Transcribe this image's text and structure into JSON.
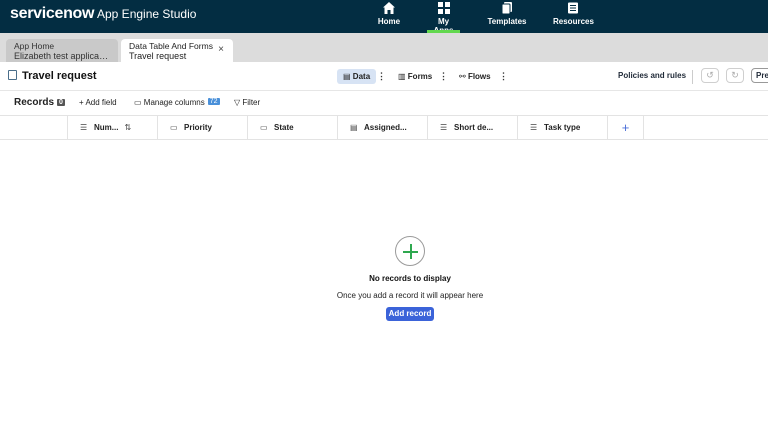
{
  "topnav": {
    "brand": "servicenow",
    "product": "App Engine Studio",
    "items": [
      {
        "label": "Home",
        "icon": "home-icon"
      },
      {
        "label": "My Apps",
        "icon": "grid-icon"
      },
      {
        "label": "Templates",
        "icon": "templates-icon"
      },
      {
        "label": "Resources",
        "icon": "book-icon"
      }
    ],
    "active_item": "My Apps",
    "accent_color": "#62d84e",
    "bg_color": "#032d42"
  },
  "tabs": [
    {
      "title": "App Home",
      "subtitle": "Elizabeth test applicati...",
      "active": false
    },
    {
      "title": "Data Table And Forms",
      "subtitle": "Travel request",
      "active": true,
      "close": "×"
    }
  ],
  "header": {
    "title": "Travel request",
    "segments": [
      {
        "label": "Data",
        "icon": "table-icon",
        "active": true
      },
      {
        "label": "Forms",
        "icon": "form-icon",
        "active": false
      },
      {
        "label": "Flows",
        "icon": "flow-icon",
        "active": false
      }
    ],
    "kebab": "⋮",
    "policies_label": "Policies and rules",
    "pre_label": "Pre"
  },
  "toolbar": {
    "records_label": "Records",
    "records_count": "0",
    "add_field": "+ Add field",
    "manage_columns": "Manage columns",
    "manage_columns_count": "72",
    "filter": "Filter"
  },
  "columns": [
    {
      "label": "Num...",
      "icon": "text-icon",
      "sort": true
    },
    {
      "label": "Priority",
      "icon": "choice-icon"
    },
    {
      "label": "State",
      "icon": "choice-icon"
    },
    {
      "label": "Assigned...",
      "icon": "reference-icon"
    },
    {
      "label": "Short de...",
      "icon": "text-icon"
    },
    {
      "label": "Task type",
      "icon": "text-icon"
    }
  ],
  "empty_state": {
    "title": "No records to display",
    "subtitle": "Once you add a record it will appear here",
    "button": "Add record"
  }
}
